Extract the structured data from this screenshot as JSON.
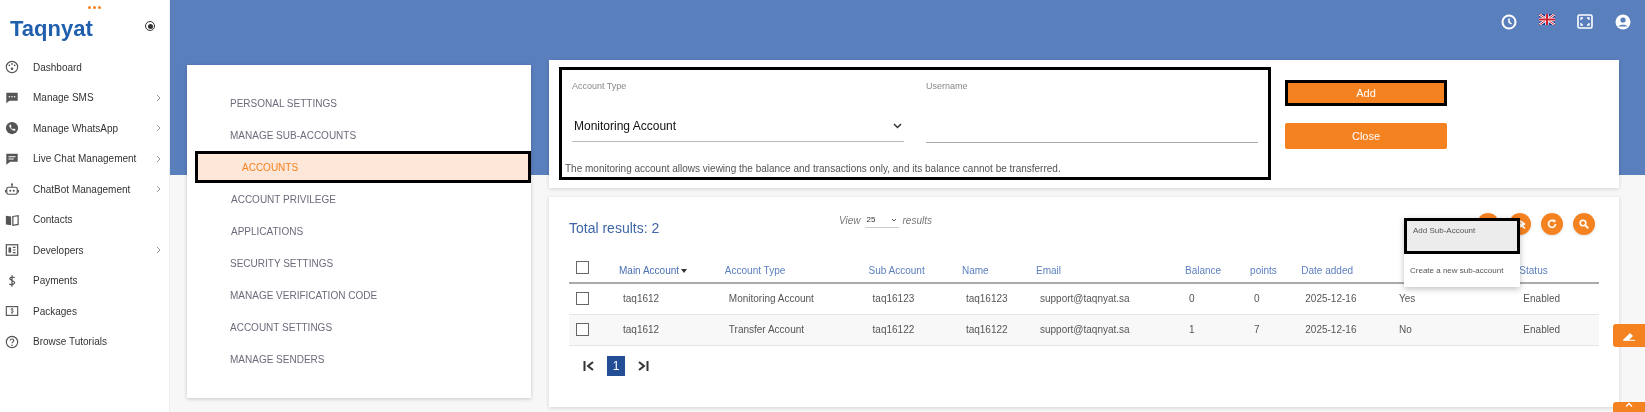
{
  "logo": {
    "text": "Taqnyat"
  },
  "sidebar": {
    "items": [
      {
        "label": "Dashboard",
        "has_submenu": false
      },
      {
        "label": "Manage SMS",
        "has_submenu": true
      },
      {
        "label": "Manage WhatsApp",
        "has_submenu": true
      },
      {
        "label": "Live Chat Management",
        "has_submenu": true
      },
      {
        "label": "ChatBot Management",
        "has_submenu": true
      },
      {
        "label": "Contacts",
        "has_submenu": false
      },
      {
        "label": "Developers",
        "has_submenu": true
      },
      {
        "label": "Payments",
        "has_submenu": false
      },
      {
        "label": "Packages",
        "has_submenu": false
      },
      {
        "label": "Browse Tutorials",
        "has_submenu": false
      }
    ]
  },
  "settings_menu": [
    {
      "label": "PERSONAL SETTINGS",
      "selected": false
    },
    {
      "label": "MANAGE SUB-ACCOUNTS",
      "selected": false,
      "children": [
        {
          "label": "ACCOUNTS",
          "selected": true
        },
        {
          "label": "ACCOUNT PRIVILEGE",
          "selected": false
        },
        {
          "label": "APPLICATIONS",
          "selected": false
        }
      ]
    },
    {
      "label": "SECURITY SETTINGS",
      "selected": false
    },
    {
      "label": "MANAGE VERIFICATION CODE",
      "selected": false
    },
    {
      "label": "ACCOUNT SETTINGS",
      "selected": false
    },
    {
      "label": "MANAGE SENDERS",
      "selected": false
    }
  ],
  "form": {
    "outlined": true,
    "account_type": {
      "label": "Account Type",
      "value": "Monitoring Account"
    },
    "username": {
      "label": "Username"
    },
    "description": "The monitoring account allows viewing the balance and transactions only, and its balance cannot be transferred.",
    "buttons": [
      {
        "label": "Add",
        "outlined": true
      },
      {
        "label": "Close",
        "outlined": false
      }
    ]
  },
  "table": {
    "total": "Total results: 2",
    "view_label": "View",
    "page_size": "25",
    "results_label": "results",
    "select_all": {
      "checked": false
    },
    "columns": [
      {
        "label": "Main Account",
        "sorted": true
      },
      {
        "label": "Account Type",
        "sorted": false
      },
      {
        "label": "Sub Account",
        "sorted": false
      },
      {
        "label": "Name",
        "sorted": false
      },
      {
        "label": "Email",
        "sorted": false
      },
      {
        "label": "Balance",
        "sorted": false
      },
      {
        "label": "points",
        "sorted": false
      },
      {
        "label": "Date added",
        "sorted": false
      },
      {
        "sorted": false
      },
      {
        "label": "Status",
        "sorted": false
      }
    ],
    "rows": [
      {
        "checked": false,
        "cells": [
          "taq1612",
          "Monitoring Account",
          "taq16123",
          "taq16123",
          "support@taqnyat.sa",
          "0",
          "0",
          "2025-12-16",
          "Yes",
          "Enabled"
        ]
      },
      {
        "checked": false,
        "cells": [
          "taq1612",
          "Transfer Account",
          "taq16122",
          "taq16122",
          "support@taqnyat.sa",
          "1",
          "7",
          "2025-12-16",
          "No",
          "Enabled"
        ]
      }
    ],
    "pagination": {
      "pages": [
        {
          "label": "1",
          "selected": true
        }
      ]
    }
  },
  "add_menu": [
    {
      "label": "Add Sub-Account",
      "selected": true
    },
    {
      "label": "Create a new sub-account",
      "selected": false
    }
  ]
}
